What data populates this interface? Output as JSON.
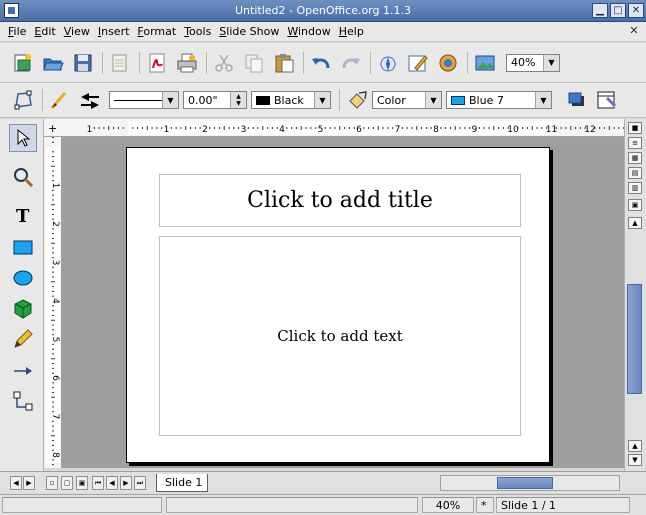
{
  "window": {
    "title": "Untitled2 - OpenOffice.org 1.1.3"
  },
  "menu": {
    "items": [
      "File",
      "Edit",
      "View",
      "Insert",
      "Format",
      "Tools",
      "Slide Show",
      "Window",
      "Help"
    ]
  },
  "toolbar": {
    "zoom": "40%"
  },
  "objectbar": {
    "line_width": "0.00\"",
    "line_color": "Black",
    "area_style": "Color",
    "area_color": "Blue 7"
  },
  "slide": {
    "title_placeholder": "Click to add title",
    "text_placeholder": "Click to add text",
    "tab_label": "Slide 1"
  },
  "ruler": {
    "h_ticks": [
      "1",
      "1",
      "2",
      "3",
      "4",
      "5",
      "6",
      "7",
      "8",
      "9",
      "10",
      "11",
      "12"
    ],
    "v_ticks": [
      "1",
      "2",
      "3",
      "4",
      "5",
      "6",
      "7",
      "8"
    ]
  },
  "status": {
    "zoom": "40%",
    "modified": "*",
    "slide_info": "Slide 1 / 1"
  },
  "colors": {
    "titlebar": "#4a6ea8",
    "workspace": "#9e9e9e",
    "scroll_thumb": "#6a88c0",
    "area_color_swatch": "#1aa3e8",
    "line_color_swatch": "#000000"
  }
}
